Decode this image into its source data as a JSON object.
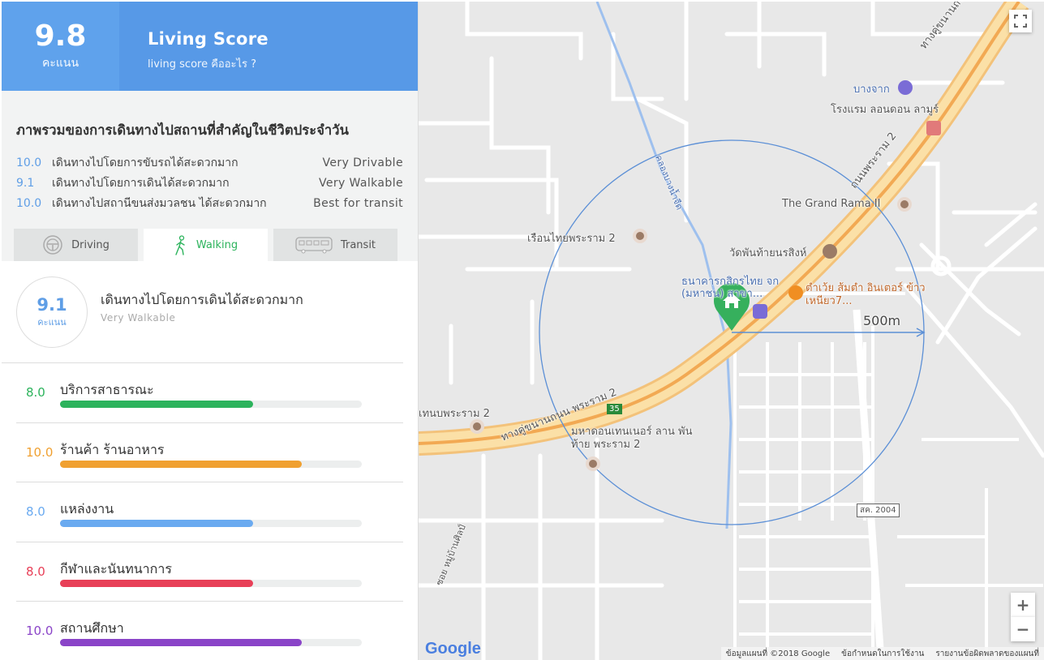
{
  "header": {
    "score": "9.8",
    "score_unit": "คะแนน",
    "title": "Living Score",
    "subtitle": "living score คืออะไร ?"
  },
  "overview": {
    "title": "ภาพรวมของการเดินทางไปสถานที่สำคัญในชีวิตประจำวัน",
    "rows": [
      {
        "num": "10.0",
        "desc": "เดินทางไปโดยการขับรถได้สะดวกมาก",
        "level": "Very Drivable"
      },
      {
        "num": "9.1",
        "desc": "เดินทางไปโดยการเดินได้สะดวกมาก",
        "level": "Very Walkable"
      },
      {
        "num": "10.0",
        "desc": "เดินทางไปสถานีขนส่งมวลชน ได้สะดวกมาก",
        "level": "Best for transit"
      }
    ]
  },
  "tabs": [
    {
      "label": "Driving",
      "icon": "steering-wheel-icon",
      "active": false
    },
    {
      "label": "Walking",
      "icon": "walking-person-icon",
      "active": true
    },
    {
      "label": "Transit",
      "icon": "bus-icon",
      "active": false
    }
  ],
  "summary": {
    "score": "9.1",
    "unit": "คะแนน",
    "title": "เดินทางไปโดยการเดินได้สะดวกมาก",
    "level": "Very Walkable"
  },
  "categories": [
    {
      "score": "8.0",
      "label": "บริการสาธารณะ",
      "fraction": 0.8,
      "color": "#2cb35c"
    },
    {
      "score": "10.0",
      "label": "ร้านค้า ร้านอาหาร",
      "fraction": 1.0,
      "color": "#f0a030"
    },
    {
      "score": "8.0",
      "label": "แหล่งงาน",
      "fraction": 0.8,
      "color": "#6aaaf0"
    },
    {
      "score": "8.0",
      "label": "กีฬาและนันทนาการ",
      "fraction": 0.8,
      "color": "#e84058"
    },
    {
      "score": "10.0",
      "label": "สถานศึกษา",
      "fraction": 1.0,
      "color": "#8a44c8"
    }
  ],
  "map": {
    "labels": {
      "bangchak": "บางจาก",
      "london_hotel": "โรงแรม ลอนดอน ลามูร์",
      "road_rama2_top": "ทางคู่ขนานถนน พระราม 2",
      "road_rama2_ne": "ถนนพระราม 2",
      "grand_rama": "The Grand Rama II",
      "canal": "คลองบางน้ำจืด",
      "ruean_thai": "เรือนไทยพระราม 2",
      "wat": "วัดพันท้ายนรสิงห์",
      "bank": "ธนาคารกสิกรไทย จก (มหาชน) สาขา...",
      "restaurant": "ตำเว้ย ส้มตำ อินเตอร์ ข้าวเหนียว7...",
      "radius": "500m",
      "road_rama2_low": "ทางคู่ขนานถนน พระราม 2",
      "lotus": "มหาดอนเทนเนอร์ ลาน พันท้าย พระราม 2",
      "rama2_left": "เทนบพระราม 2",
      "route_35": "35",
      "road_2004": "สค. 2004",
      "soi": "ซอย หมู่บ้านศิลป์"
    },
    "attribution": [
      "ข้อมูลแผนที่ ©2018 Google",
      "ข้อกำหนดในการใช้งาน",
      "รายงานข้อผิดพลาดของแผนที่"
    ],
    "google_logo": "Google",
    "zoom_in": "+",
    "zoom_out": "−"
  }
}
